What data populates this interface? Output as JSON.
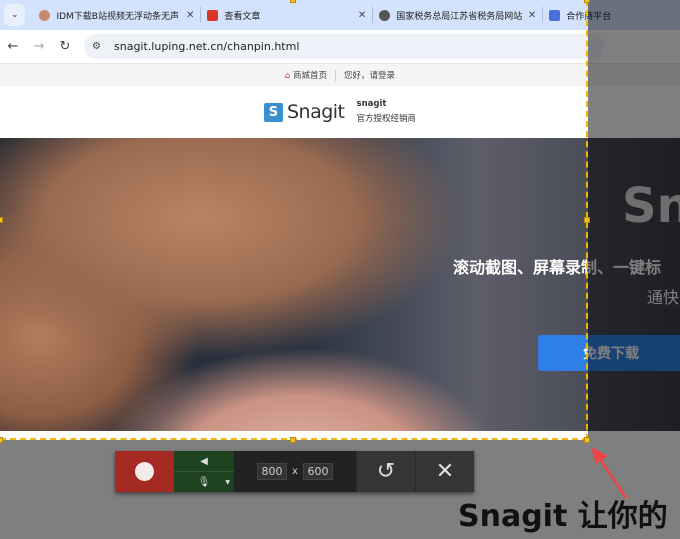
{
  "browser": {
    "tabs": [
      {
        "title": "IDM下载B站视频无浮动条无声",
        "icon": "avatar-icon"
      },
      {
        "title": "查看文章",
        "icon": "store-icon"
      },
      {
        "title": "国家税务总局江苏省税务局网站",
        "icon": "globe-icon"
      },
      {
        "title": "合作商平台",
        "icon": "app-icon"
      }
    ],
    "tab_menu": "⌄",
    "url": "snagit.luping.net.cn/chanpin.html"
  },
  "site": {
    "topbar": {
      "home": "商城首页",
      "login": "您好，请登录"
    },
    "logo_mark": "S",
    "logo_word": "Snagit",
    "logo_brand": "snagit",
    "logo_sub": "官方授权经销商",
    "hero_title": "Sn",
    "hero_slogan": "滚动截图、屏幕录制、一键标",
    "hero_slogan2": "通快",
    "download": "免费下载",
    "section_title": "Snagit 让你的"
  },
  "capture": {
    "width": "800",
    "height": "600",
    "times": "x",
    "accent": "#f2b705",
    "record_color": "#a52a24",
    "audio_color": "#1e4220"
  }
}
